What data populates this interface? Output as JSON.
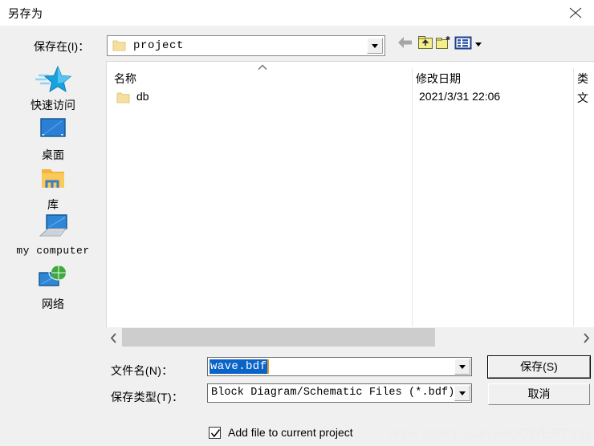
{
  "window": {
    "title": "另存为",
    "close_icon": "close-icon"
  },
  "toolbar": {
    "path_label": "保存在(I)：",
    "path_value": "project",
    "path_icon": "folder-icon",
    "buttons": [
      {
        "name": "back-button",
        "icon": "arrow-left-icon",
        "label": ""
      },
      {
        "name": "up-one-level-button",
        "icon": "folder-up-icon",
        "label": ""
      },
      {
        "name": "new-folder-button",
        "icon": "new-folder-icon",
        "label": ""
      },
      {
        "name": "views-button",
        "icon": "views-icon",
        "label": ""
      }
    ]
  },
  "sidebar": {
    "items": [
      {
        "label": "快速访问",
        "icon": "star-icon",
        "mono": false
      },
      {
        "label": "桌面",
        "icon": "desktop-monitor-icon",
        "mono": false
      },
      {
        "label": "库",
        "icon": "libraries-folder-icon",
        "mono": false
      },
      {
        "label": "my computer",
        "icon": "computer-icon",
        "mono": true
      },
      {
        "label": "网络",
        "icon": "network-globe-icon",
        "mono": false
      }
    ]
  },
  "filelist": {
    "columns": [
      "名称",
      "修改日期",
      "类"
    ],
    "sort_column": "名称",
    "sort_direction": "ascending",
    "rows": [
      {
        "name": "db",
        "icon": "folder-icon",
        "date_modified": "2021/3/31 22:06",
        "type": "文"
      }
    ],
    "scrollbar": {
      "left_arrow": "chevron-left-icon",
      "right_arrow": "chevron-right-icon"
    }
  },
  "form": {
    "filename_label": "文件名(N)：",
    "filename_value": "wave.bdf",
    "filetype_label": "保存类型(T)：",
    "filetype_value": "Block Diagram/Schematic Files (*.bdf)",
    "save_label": "保存(S)",
    "cancel_label": "取消",
    "add_to_project_label": "Add file to current project",
    "add_to_project_checked": true,
    "selection_color": "#0a64c8",
    "caret_color": "#e8962a"
  },
  "watermark": "https://blog.csdn.net/QWERTYzxw"
}
